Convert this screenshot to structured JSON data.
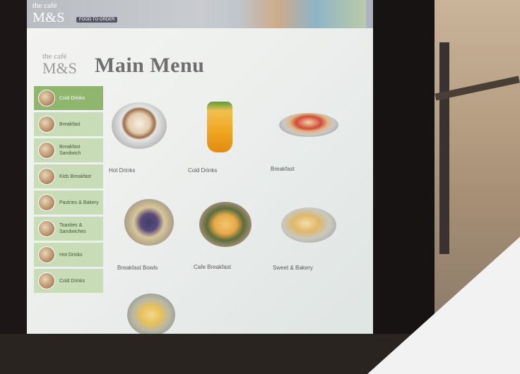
{
  "banner": {
    "logo_top": "the café",
    "logo_main": "M&S",
    "badge": "FOOD TO ORDER"
  },
  "header": {
    "logo_top": "the café",
    "logo_main": "M&S",
    "title": "Main Menu"
  },
  "sidebar": {
    "items": [
      {
        "label": "Cold Drinks",
        "active": true
      },
      {
        "label": "Breakfast",
        "active": false
      },
      {
        "label": "Breakfast Sandwich",
        "active": false
      },
      {
        "label": "Kids Breakfast",
        "active": false
      },
      {
        "label": "Pastries & Bakery",
        "active": false
      },
      {
        "label": "Toasties & Sandwiches",
        "active": false
      },
      {
        "label": "Hot Drinks",
        "active": false
      },
      {
        "label": "Cold Drinks",
        "active": false
      }
    ]
  },
  "menu": {
    "tiles": [
      {
        "label": "Hot Drinks",
        "icon": "coffee-cup"
      },
      {
        "label": "Cold Drinks",
        "icon": "juice-glass"
      },
      {
        "label": "Breakfast",
        "icon": "breakfast-bun"
      },
      {
        "label": "Breakfast Bowls",
        "icon": "fruit-bowl"
      },
      {
        "label": "Cafe Breakfast",
        "icon": "toast-plate"
      },
      {
        "label": "Sweet & Bakery",
        "icon": "scone-plate"
      },
      {
        "label": "",
        "icon": "cake-plate"
      }
    ]
  },
  "colors": {
    "sidebar_active": "#8fb56f",
    "sidebar_item": "#c8dcb8",
    "title_text": "#6e6e6e"
  }
}
